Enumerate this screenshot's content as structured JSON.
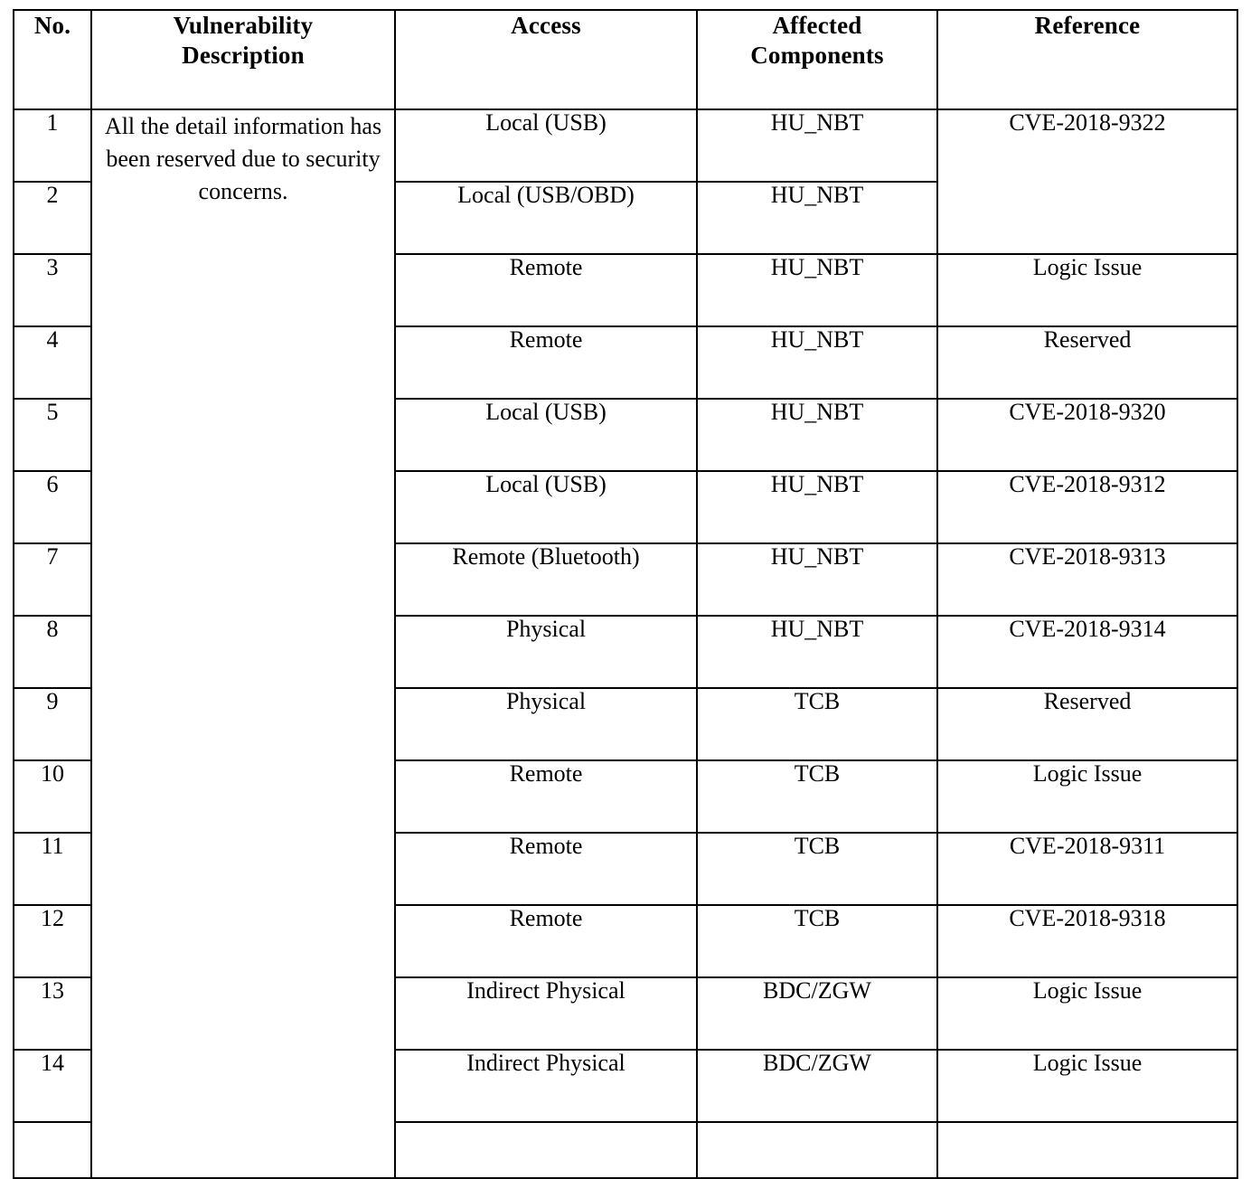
{
  "table": {
    "headers": [
      {
        "id": "no",
        "lines": [
          "No."
        ]
      },
      {
        "id": "description",
        "lines": [
          "Vulnerability",
          "Description"
        ]
      },
      {
        "id": "access",
        "lines": [
          "Access"
        ]
      },
      {
        "id": "affected",
        "lines": [
          "Affected",
          "Components"
        ]
      },
      {
        "id": "reference",
        "lines": [
          "Reference"
        ]
      }
    ],
    "description_cell": "All the detail information has been reserved due to security concerns.",
    "colors": {
      "header_background": "#aeabab",
      "highlight_background": "#c9d6a3",
      "border": "#000000",
      "cell_background": "#ffffff",
      "text": "#000000"
    },
    "merged_reference": {
      "value": "CVE-2018-9322",
      "rowspan": 2,
      "highlighted": true
    },
    "rows": [
      {
        "no": "1",
        "access": "Local (USB)",
        "affected": "HU_NBT",
        "reference": "CVE-2018-9322",
        "highlighted": true
      },
      {
        "no": "2",
        "access": "Local (USB/OBD)",
        "affected": "HU_NBT",
        "reference": "CVE-2018-9322",
        "highlighted": true
      },
      {
        "no": "3",
        "access": "Remote",
        "affected": "HU_NBT",
        "reference": "Logic Issue",
        "highlighted": false
      },
      {
        "no": "4",
        "access": "Remote",
        "affected": "HU_NBT",
        "reference": "Reserved",
        "highlighted": false
      },
      {
        "no": "5",
        "access": "Local (USB)",
        "affected": "HU_NBT",
        "reference": "CVE-2018-9320",
        "highlighted": true
      },
      {
        "no": "6",
        "access": "Local (USB)",
        "affected": "HU_NBT",
        "reference": "CVE-2018-9312",
        "highlighted": true
      },
      {
        "no": "7",
        "access": "Remote (Bluetooth)",
        "affected": "HU_NBT",
        "reference": "CVE-2018-9313",
        "highlighted": true
      },
      {
        "no": "8",
        "access": "Physical",
        "affected": "HU_NBT",
        "reference": "CVE-2018-9314",
        "highlighted": true
      },
      {
        "no": "9",
        "access": "Physical",
        "affected": "TCB",
        "reference": "Reserved",
        "highlighted": false
      },
      {
        "no": "10",
        "access": "Remote",
        "affected": "TCB",
        "reference": "Logic Issue",
        "highlighted": false
      },
      {
        "no": "11",
        "access": "Remote",
        "affected": "TCB",
        "reference": "CVE-2018-9311",
        "highlighted": true
      },
      {
        "no": "12",
        "access": "Remote",
        "affected": "TCB",
        "reference": "CVE-2018-9318",
        "highlighted": true
      },
      {
        "no": "13",
        "access": "Indirect Physical",
        "affected": "BDC/ZGW",
        "reference": "Logic Issue",
        "highlighted": false
      },
      {
        "no": "14",
        "access": "Indirect Physical",
        "affected": "BDC/ZGW",
        "reference": "Logic Issue",
        "highlighted": false
      },
      {
        "no": "",
        "access": "",
        "affected": "",
        "reference": "",
        "highlighted": false
      }
    ]
  }
}
